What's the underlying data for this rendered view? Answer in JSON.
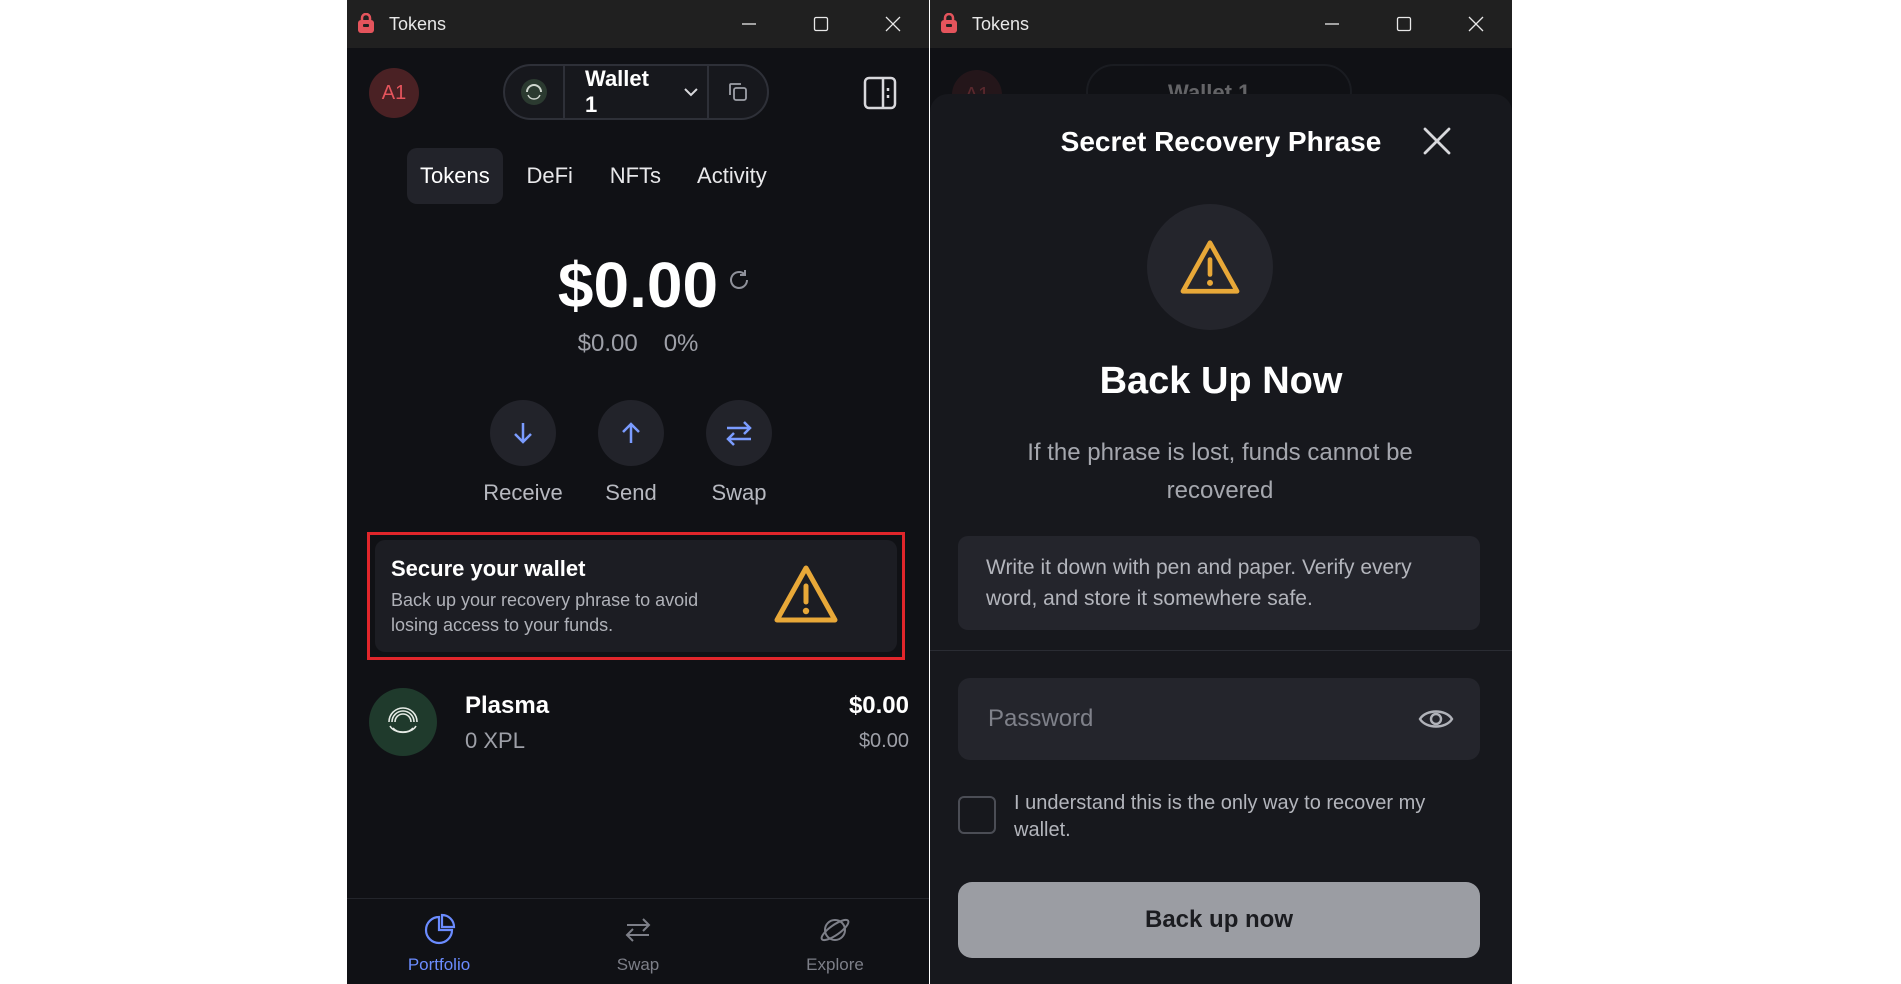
{
  "left_window": {
    "title": "Tokens",
    "avatar": "A1",
    "wallet_name": "Wallet 1",
    "tabs": [
      {
        "label": "Tokens",
        "active": true
      },
      {
        "label": "DeFi",
        "active": false
      },
      {
        "label": "NFTs",
        "active": false
      },
      {
        "label": "Activity",
        "active": false
      }
    ],
    "balance": "$0.00",
    "change_value": "$0.00",
    "change_percent": "0%",
    "actions": {
      "receive": "Receive",
      "send": "Send",
      "swap": "Swap"
    },
    "secure_card": {
      "title": "Secure your wallet",
      "description": "Back up your recovery phrase to avoid losing access to your funds."
    },
    "token": {
      "name": "Plasma",
      "amount": "0 XPL",
      "value": "$0.00",
      "value_secondary": "$0.00"
    },
    "bottom_nav": {
      "portfolio": "Portfolio",
      "swap": "Swap",
      "explore": "Explore"
    }
  },
  "right_window": {
    "title": "Tokens",
    "bg_avatar": "A1",
    "bg_wallet_name": "Wallet 1",
    "sheet": {
      "title": "Secret Recovery Phrase",
      "heading": "Back Up Now",
      "description": "If the phrase is lost, funds cannot be recovered",
      "info": "Write it down with pen and paper. Verify every word, and store it somewhere safe.",
      "password_placeholder": "Password",
      "checkbox_label": "I understand this is the only way to recover my wallet.",
      "button_label": "Back up now"
    }
  },
  "colors": {
    "background": "#101115",
    "accent": "#6b8cff",
    "warning": "#e8a838",
    "highlight_outline": "#e1262b",
    "avatar": "#e4545c"
  }
}
